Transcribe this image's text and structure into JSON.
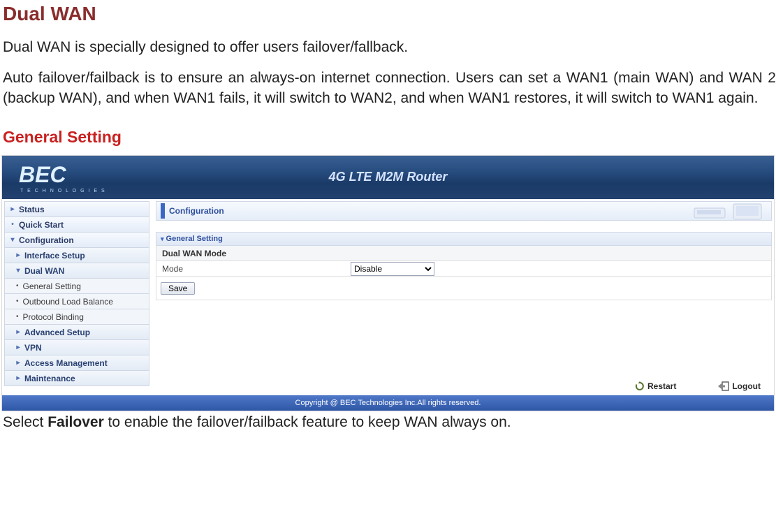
{
  "heading": "Dual WAN",
  "intro": "Dual WAN is specially designed to offer users failover/fallback.",
  "desc": "Auto failover/failback is to ensure an always-on internet connection. Users can set a WAN1 (main WAN) and WAN 2 (backup WAN), and when WAN1 fails, it will switch to WAN2, and when WAN1 restores, it will switch to WAN1 again.",
  "subheading": "General Setting",
  "after_prefix": "Select ",
  "after_bold": "Failover",
  "after_suffix": " to enable the failover/failback feature to keep WAN always on.",
  "router": {
    "logo_text": "BEC",
    "logo_sub": "T E C H N O L O G I E S",
    "header_title": "4G LTE M2M Router",
    "sidebar": {
      "items": [
        {
          "label": "Status",
          "type": "top",
          "icon": "right"
        },
        {
          "label": "Quick Start",
          "type": "top",
          "icon": "dot"
        },
        {
          "label": "Configuration",
          "type": "top",
          "icon": "down"
        },
        {
          "label": "Interface Setup",
          "type": "sub",
          "icon": "right"
        },
        {
          "label": "Dual WAN",
          "type": "sub",
          "icon": "down"
        },
        {
          "label": "General Setting",
          "type": "leaf"
        },
        {
          "label": "Outbound Load Balance",
          "type": "leaf"
        },
        {
          "label": "Protocol Binding",
          "type": "leaf"
        },
        {
          "label": "Advanced Setup",
          "type": "sub",
          "icon": "right"
        },
        {
          "label": "VPN",
          "type": "sub",
          "icon": "right"
        },
        {
          "label": "Access Management",
          "type": "sub",
          "icon": "right"
        },
        {
          "label": "Maintenance",
          "type": "sub",
          "icon": "right"
        }
      ]
    },
    "panel_title": "Configuration",
    "section_title": "General Setting",
    "row_header": "Dual WAN Mode",
    "mode_label": "Mode",
    "mode_value": "Disable",
    "save_label": "Save",
    "restart_label": "Restart",
    "logout_label": "Logout",
    "copyright": "Copyright @ BEC Technologies Inc.All rights reserved."
  }
}
